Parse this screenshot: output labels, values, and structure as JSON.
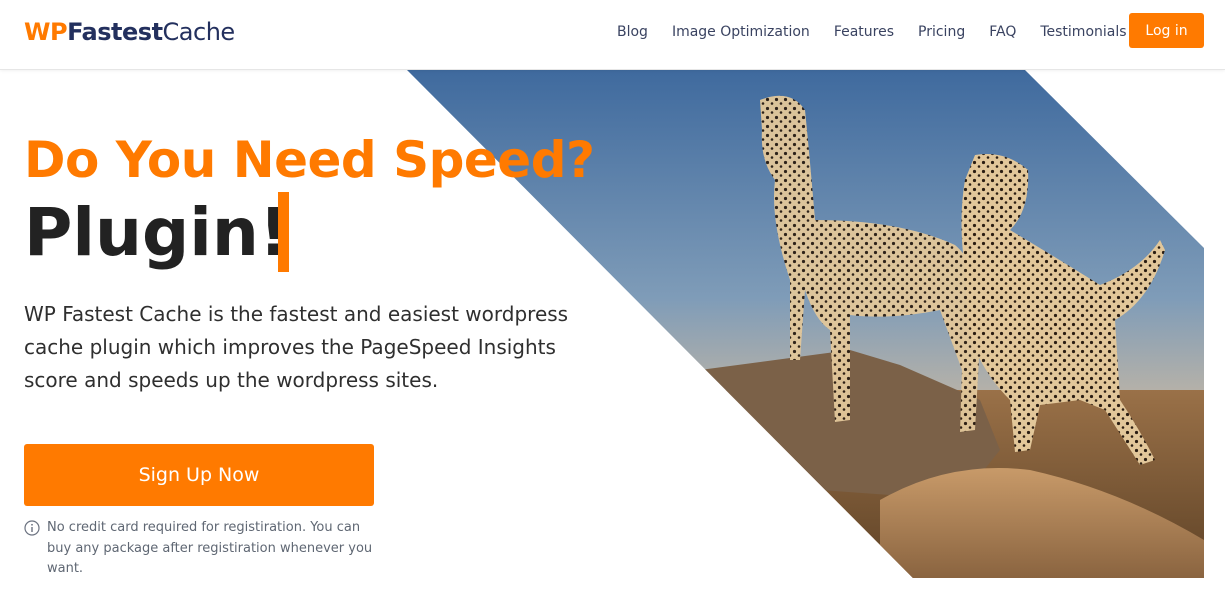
{
  "logo": {
    "part1": "WP",
    "part2": "Fastest",
    "part3": "Cache"
  },
  "nav": {
    "items": [
      "Blog",
      "Image Optimization",
      "Features",
      "Pricing",
      "FAQ",
      "Testimonials"
    ],
    "login_label": "Log in"
  },
  "hero": {
    "headline_line1": "Do You Need Speed?",
    "headline_line2": "Plugin!",
    "description": "WP Fastest Cache is the fastest and easiest wordpress cache plugin which improves the PageSpeed Insights score and speeds up the wordpress sites.",
    "signup_label": "Sign Up Now",
    "note": "No credit card required for registiration. You can buy any package after registiration whenever you want.",
    "note_icon": "info-icon",
    "image_icon": "cheetahs-photo"
  },
  "colors": {
    "accent": "#ff7a00",
    "brand_dark": "#23305e",
    "text": "#2b2b2b",
    "muted": "#5f6773"
  }
}
